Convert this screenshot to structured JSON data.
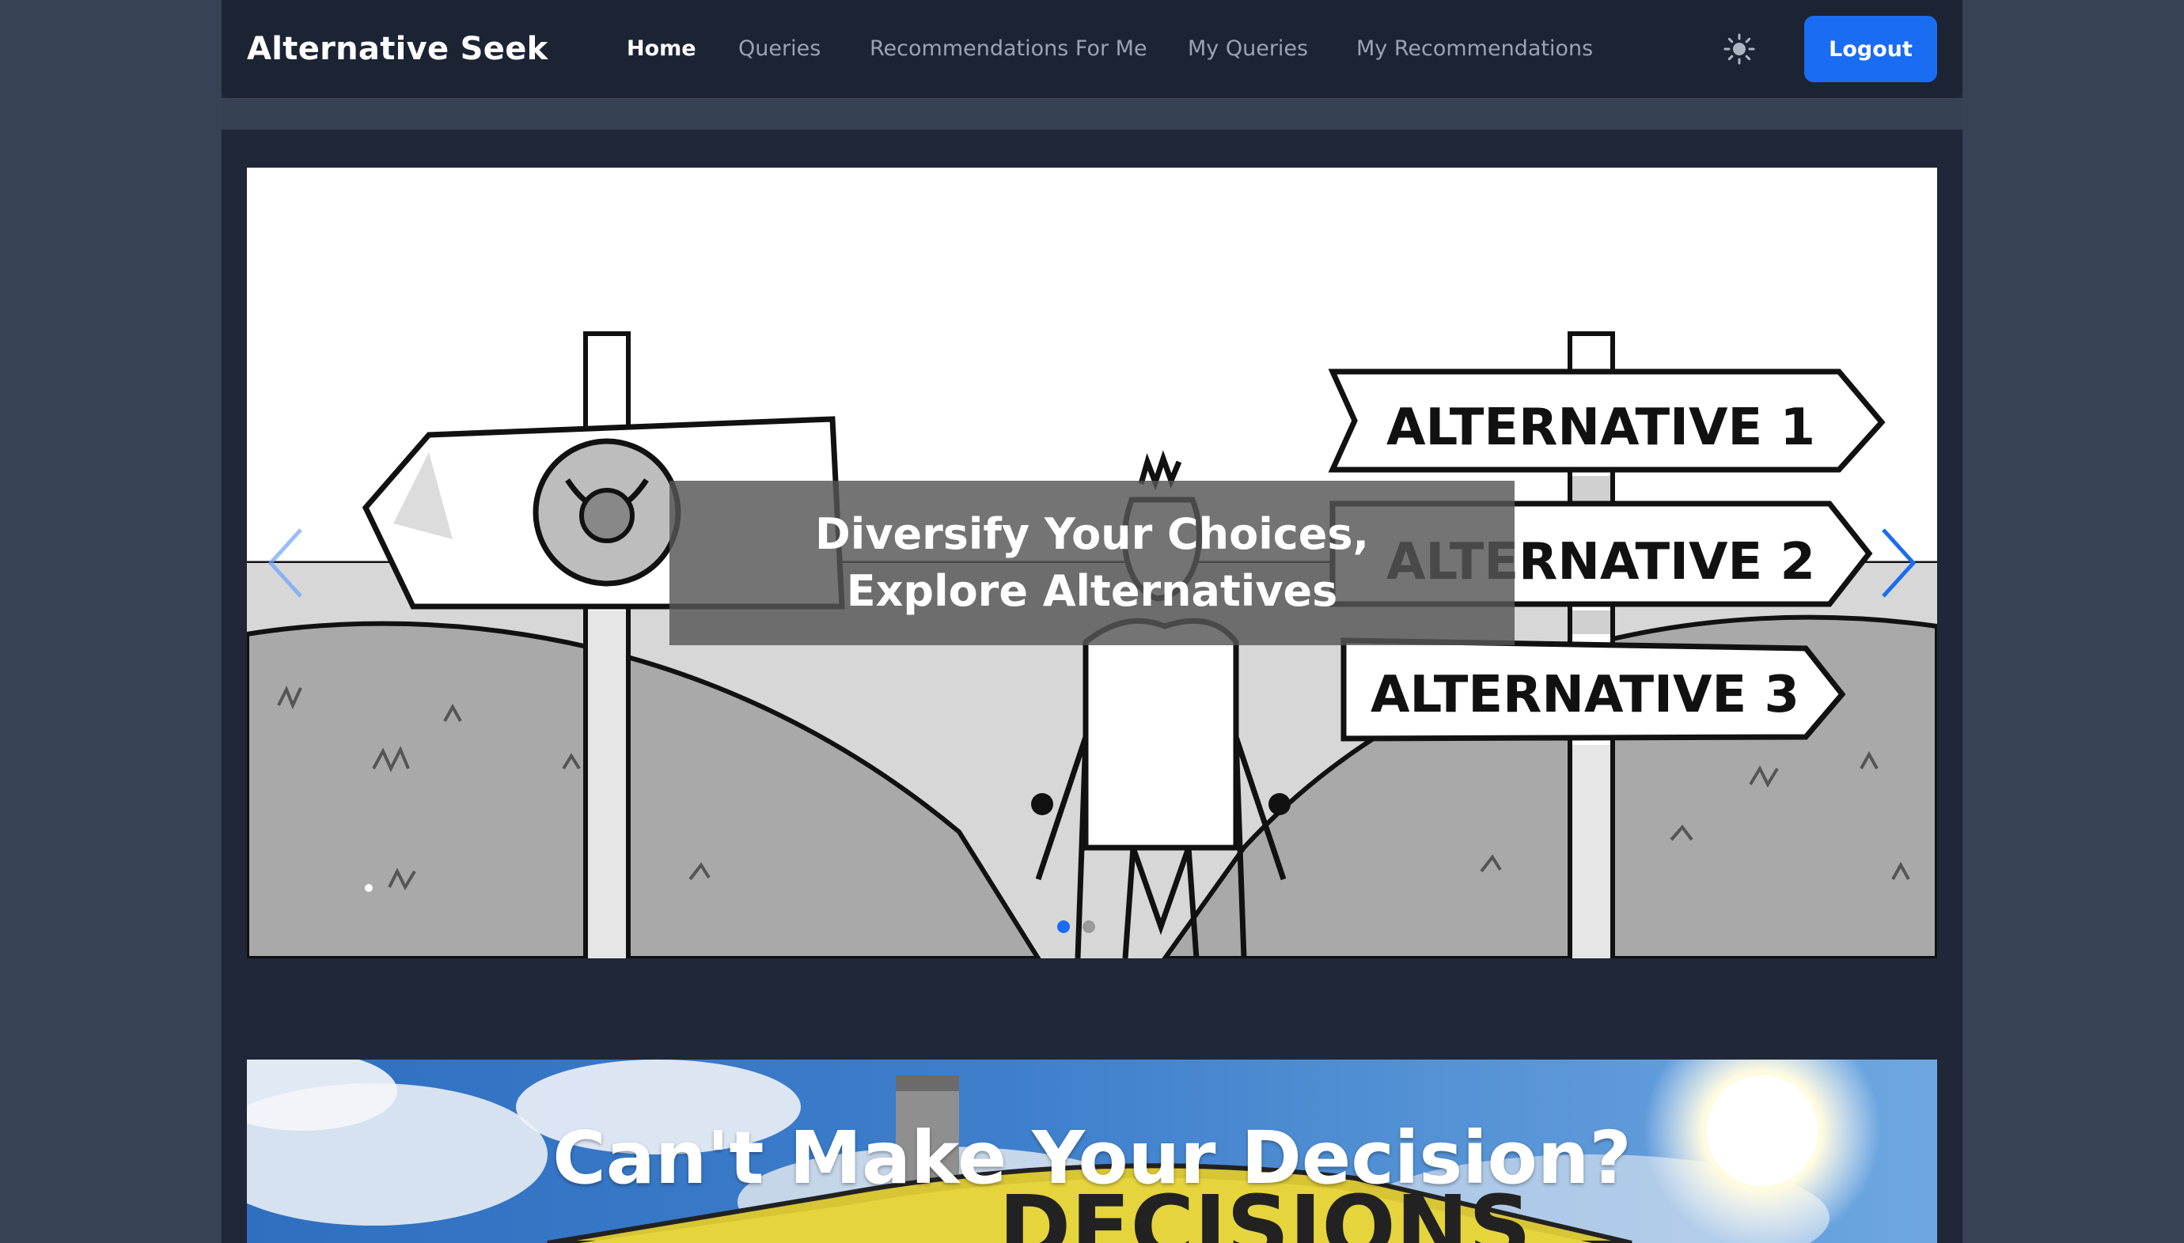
{
  "navbar": {
    "brand": "Alternative Seek",
    "links": [
      {
        "label": "Home",
        "active": true
      },
      {
        "label": "Queries",
        "active": false
      },
      {
        "label": "Recommendations For Me",
        "active": false
      },
      {
        "label": "My Queries",
        "active": false
      },
      {
        "label": "My Recommendations",
        "active": false
      }
    ],
    "theme_toggle_icon": "sun-icon",
    "logout_label": "Logout"
  },
  "carousel": {
    "caption": "Diversify Your Choices, Explore Alternatives",
    "signs": [
      "ALTERNATIVE 1",
      "ALTERNATIVE 2",
      "ALTERNATIVE 3"
    ],
    "slide_count": 2,
    "active_slide": 1,
    "prev_icon": "chevron-left-icon",
    "next_icon": "chevron-right-icon"
  },
  "banner": {
    "title": "Can't Make Your Decision?"
  },
  "colors": {
    "page_bg": "#374254",
    "container_bg": "#1f2738",
    "navbar_bg": "#1c2434",
    "accent": "#1a6cf2"
  }
}
